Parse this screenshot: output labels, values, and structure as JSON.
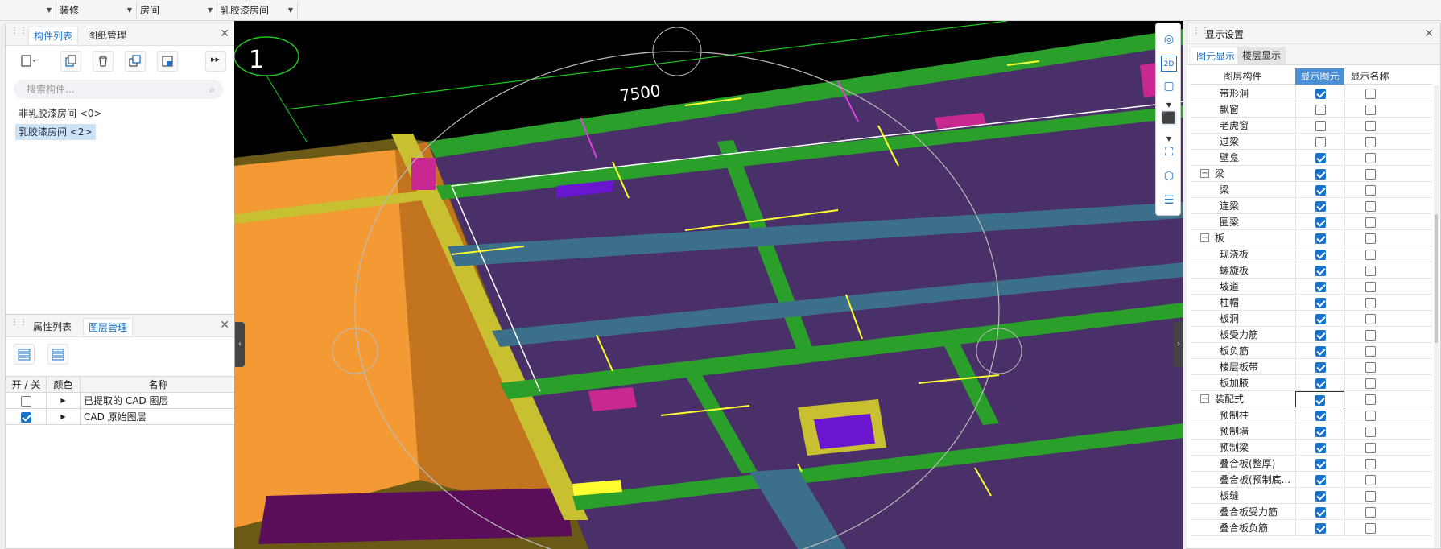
{
  "topbar": {
    "combos": [
      {
        "label": ""
      },
      {
        "label": "装修"
      },
      {
        "label": "房间"
      },
      {
        "label": "乳胶漆房间"
      }
    ]
  },
  "component_panel": {
    "tabs": [
      "构件列表",
      "图纸管理"
    ],
    "search_placeholder": "搜索构件...",
    "items": [
      {
        "label": "非乳胶漆房间 <0>"
      },
      {
        "label": "乳胶漆房间 <2>"
      }
    ]
  },
  "layer_panel": {
    "tabs": [
      "属性列表",
      "图层管理"
    ],
    "headers": [
      "开 / 关",
      "颜色",
      "名称"
    ],
    "rows": [
      {
        "checked": false,
        "name": "已提取的 CAD 图层"
      },
      {
        "checked": true,
        "name": "CAD 原始图层"
      }
    ]
  },
  "viewport": {
    "dimension_label": "7500",
    "axis_label": "1"
  },
  "display_panel": {
    "title": "显示设置",
    "tabs": [
      "图元显示",
      "楼层显示"
    ],
    "headers": [
      "图层构件",
      "显示图元",
      "显示名称"
    ],
    "rows": [
      {
        "name": "带形洞",
        "level": 2,
        "show": true,
        "name_show": false
      },
      {
        "name": "飘窗",
        "level": 2,
        "show": false,
        "name_show": false
      },
      {
        "name": "老虎窗",
        "level": 2,
        "show": false,
        "name_show": false
      },
      {
        "name": "过梁",
        "level": 2,
        "show": false,
        "name_show": false
      },
      {
        "name": "壁龛",
        "level": 2,
        "show": true,
        "name_show": false
      },
      {
        "name": "梁",
        "level": 1,
        "show": true,
        "name_show": false
      },
      {
        "name": "梁",
        "level": 2,
        "show": true,
        "name_show": false
      },
      {
        "name": "连梁",
        "level": 2,
        "show": true,
        "name_show": false
      },
      {
        "name": "圈梁",
        "level": 2,
        "show": true,
        "name_show": false
      },
      {
        "name": "板",
        "level": 1,
        "show": true,
        "name_show": false
      },
      {
        "name": "现浇板",
        "level": 2,
        "show": true,
        "name_show": false
      },
      {
        "name": "螺旋板",
        "level": 2,
        "show": true,
        "name_show": false
      },
      {
        "name": "坡道",
        "level": 2,
        "show": true,
        "name_show": false
      },
      {
        "name": "柱帽",
        "level": 2,
        "show": true,
        "name_show": false
      },
      {
        "name": "板洞",
        "level": 2,
        "show": true,
        "name_show": false
      },
      {
        "name": "板受力筋",
        "level": 2,
        "show": true,
        "name_show": false
      },
      {
        "name": "板负筋",
        "level": 2,
        "show": true,
        "name_show": false
      },
      {
        "name": "楼层板带",
        "level": 2,
        "show": true,
        "name_show": false
      },
      {
        "name": "板加腋",
        "level": 2,
        "show": true,
        "name_show": false
      },
      {
        "name": "装配式",
        "level": 1,
        "show": true,
        "name_show": false
      },
      {
        "name": "预制柱",
        "level": 2,
        "show": true,
        "name_show": false
      },
      {
        "name": "预制墙",
        "level": 2,
        "show": true,
        "name_show": false
      },
      {
        "name": "预制梁",
        "level": 2,
        "show": true,
        "name_show": false
      },
      {
        "name": "叠合板(整厚)",
        "level": 2,
        "show": true,
        "name_show": false
      },
      {
        "name": "叠合板(预制底...",
        "level": 2,
        "show": true,
        "name_show": false
      },
      {
        "name": "板缝",
        "level": 2,
        "show": true,
        "name_show": false
      },
      {
        "name": "叠合板受力筋",
        "level": 2,
        "show": true,
        "name_show": false
      },
      {
        "name": "叠合板负筋",
        "level": 2,
        "show": true,
        "name_show": false
      }
    ]
  },
  "colors": {
    "accent": "#1a73c8",
    "selected": "#cfe3f7",
    "slab": "#4a3068",
    "beam": "#2aa02a",
    "wall": "#f39a34"
  }
}
